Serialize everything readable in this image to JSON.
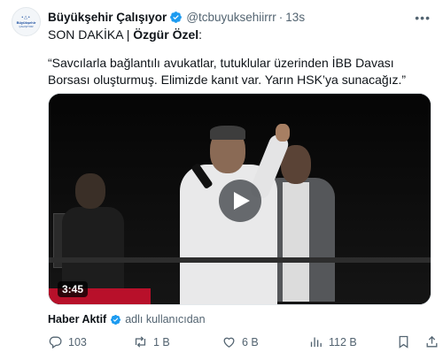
{
  "tweet": {
    "author": {
      "avatar_text": "BÜYÜKŞEHİR ÇALIŞIYOR",
      "name": "Büyükşehir Çalışıyor",
      "handle": "@tcbuyuksehiirrr",
      "time": "13s"
    },
    "text": {
      "prefix": "SON DAKİKA | ",
      "speaker": "Özgür Özel",
      "speaker_suffix": ":",
      "quote": "“Savcılarla bağlantılı avukatlar, tutuklular üzerinden İBB Davası Borsası oluşturmuş. Elimizde kanıt var. Yarın HSK’ya sunacağız.”"
    },
    "media": {
      "duration": "3:45"
    },
    "source": {
      "name": "Haber Aktif",
      "via": "adlı kullanıcıdan"
    },
    "stats": {
      "replies": "103",
      "retweets": "1 B",
      "likes": "6 B",
      "views": "112 B"
    },
    "colors": {
      "verified": "#1d9bf0",
      "muted": "#536471",
      "text": "#0f1419"
    }
  }
}
